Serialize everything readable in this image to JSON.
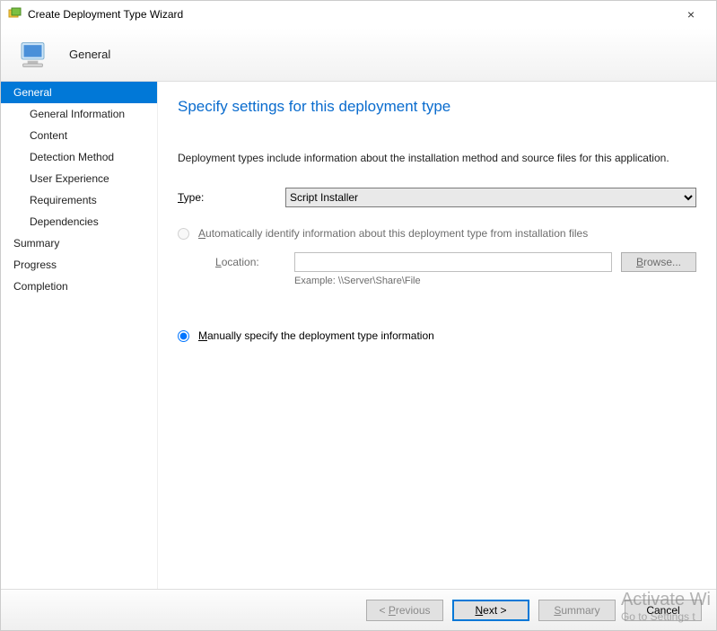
{
  "window": {
    "title": "Create Deployment Type Wizard",
    "close_label": "×"
  },
  "banner": {
    "title": "General"
  },
  "sidebar": {
    "items": [
      {
        "label": "General",
        "sub": false,
        "active": true
      },
      {
        "label": "General Information",
        "sub": true,
        "active": false
      },
      {
        "label": "Content",
        "sub": true,
        "active": false
      },
      {
        "label": "Detection Method",
        "sub": true,
        "active": false
      },
      {
        "label": "User Experience",
        "sub": true,
        "active": false
      },
      {
        "label": "Requirements",
        "sub": true,
        "active": false
      },
      {
        "label": "Dependencies",
        "sub": true,
        "active": false
      },
      {
        "label": "Summary",
        "sub": false,
        "active": false
      },
      {
        "label": "Progress",
        "sub": false,
        "active": false
      },
      {
        "label": "Completion",
        "sub": false,
        "active": false
      }
    ]
  },
  "content": {
    "heading": "Specify settings for this deployment type",
    "description": "Deployment types include information about the installation method and source files for this application.",
    "type_label_pre": "T",
    "type_label_post": "ype:",
    "type_value": "Script Installer",
    "radio_auto_pre": "A",
    "radio_auto_post": "utomatically identify information about this deployment type from installation files",
    "location_label_pre": "L",
    "location_label_post": "ocation:",
    "location_value": "",
    "browse_pre": "B",
    "browse_post": "rowse...",
    "example_label": "Example: \\\\Server\\Share\\File",
    "radio_manual_pre": "M",
    "radio_manual_post": "anually specify the deployment type information",
    "radio_selected": "manual"
  },
  "footer": {
    "previous_pre": "< ",
    "previous_u": "P",
    "previous_post": "revious",
    "next_u": "N",
    "next_post": "ext >",
    "summary_u": "S",
    "summary_post": "ummary",
    "cancel": "Cancel"
  },
  "watermark": {
    "line1": "Activate Wi",
    "line2": "Go to Settings t"
  }
}
